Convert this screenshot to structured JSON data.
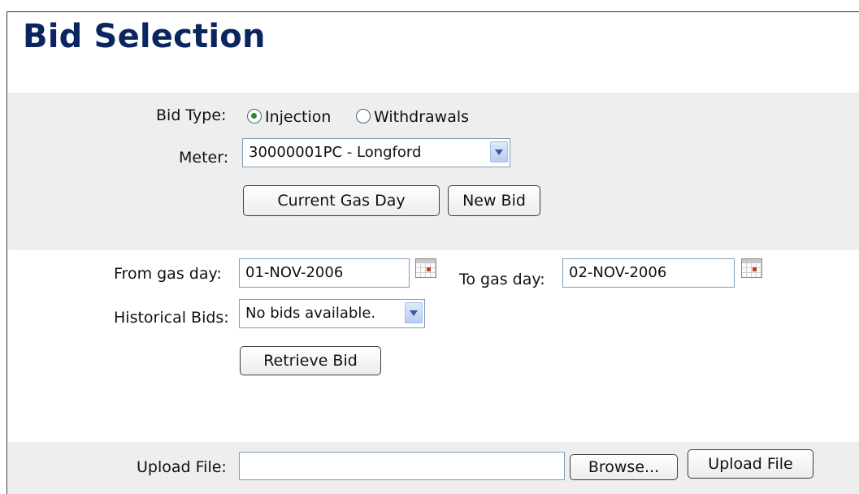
{
  "page": {
    "title": "Bid Selection"
  },
  "bid_section": {
    "bid_type_label": "Bid Type:",
    "bid_type_options": [
      "Injection",
      "Withdrawals"
    ],
    "bid_type_selected": "Injection",
    "meter_label": "Meter:",
    "meter_value": "30000001PC - Longford",
    "current_gas_day_button": "Current Gas Day",
    "new_bid_button": "New Bid"
  },
  "history_section": {
    "from_label": "From gas day:",
    "from_value": "01-NOV-2006",
    "to_label": "To gas day:",
    "to_value": "02-NOV-2006",
    "historical_label": "Historical Bids:",
    "historical_value": "No bids available.",
    "retrieve_button": "Retrieve Bid"
  },
  "upload_section": {
    "upload_label": "Upload File:",
    "upload_value": "",
    "browse_button": "Browse...",
    "upload_button": "Upload File"
  }
}
